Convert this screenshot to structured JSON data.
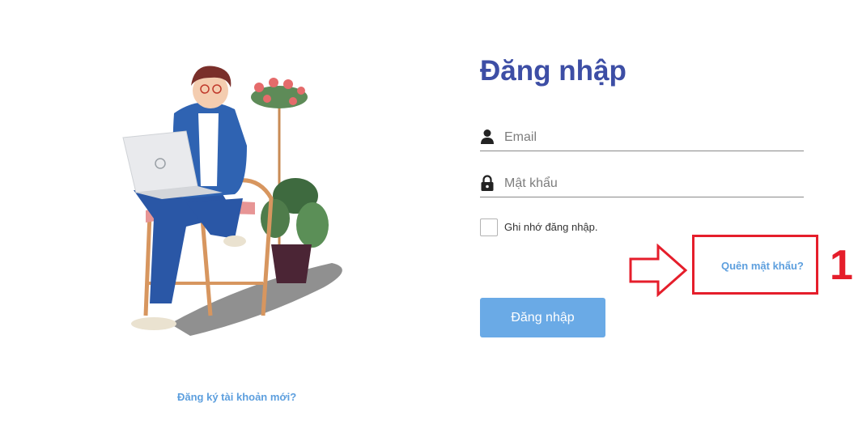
{
  "illustration": {
    "icon": "person-with-laptop-illustration"
  },
  "register_link": "Đăng ký tài khoản mới?",
  "form": {
    "title": "Đăng nhập",
    "email": {
      "icon": "user-icon",
      "placeholder": "Email",
      "value": ""
    },
    "password": {
      "icon": "lock-icon",
      "placeholder": "Mật khẩu",
      "value": ""
    },
    "remember": {
      "label": "Ghi nhớ đăng nhập.",
      "checked": false
    },
    "forgot_password": "Quên mật khẩu?",
    "submit_label": "Đăng nhập"
  },
  "annotation": {
    "step": "1",
    "color": "#e51e2b",
    "icon": "right-arrow-outline-icon"
  },
  "colors": {
    "title": "#3d4ea5",
    "link": "#5d9fde",
    "button": "#6aaae6",
    "annotation": "#e51e2b"
  }
}
